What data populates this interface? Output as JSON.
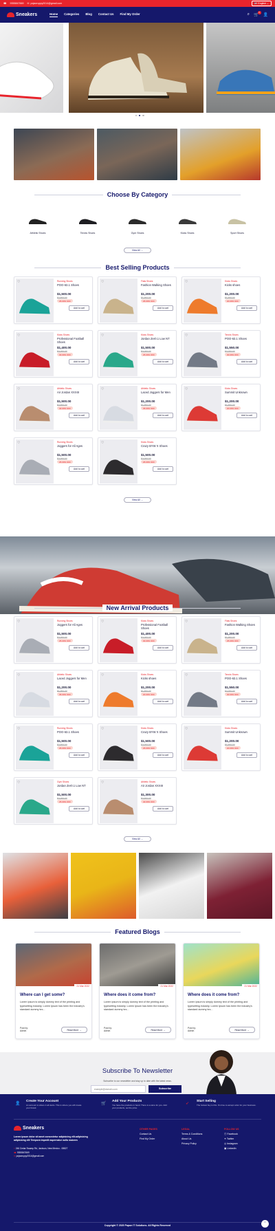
{
  "topbar": {
    "phone": "9355847669",
    "email": "pojaoruppy2014@gmail.com",
    "language": "English"
  },
  "nav": {
    "brand": "Sneakers",
    "items": [
      "Home",
      "Categories",
      "Blog",
      "Contact Us",
      "Find My Order"
    ],
    "cart_count": "0"
  },
  "categories": {
    "title": "Choose By Category",
    "items": [
      "Athletic Shoes",
      "Tennis Shoes",
      "Gym Shoes",
      "Kicks Shoes",
      "Sport Shoes"
    ],
    "view_all": "View All"
  },
  "best": {
    "title": "Best Selling Products",
    "view_all": "View All",
    "add_label": "Add to cart",
    "products": [
      {
        "cat": "Running Shoes",
        "name": "POO-63.1 Shoes",
        "price": "$1,500.00",
        "old": "$2,500.00",
        "off": "25.00% OFF",
        "color": "#1aa398"
      },
      {
        "cat": "Flats Shoes",
        "name": "Fashion Walking Shoes",
        "price": "$1,200.00",
        "old": "$1,900.00",
        "off": "25.00% OFF",
        "color": "#c9b38c"
      },
      {
        "cat": "Kicks Shoes",
        "name": "Kicks shoes",
        "price": "$1,200.00",
        "old": "$1,500.00",
        "off": "20.00% OFF",
        "color": "#ee7b2c"
      },
      {
        "cat": "Kicks Shoes",
        "name": "Professional Football Shoes",
        "price": "$1,400.00",
        "old": "$2,000.00",
        "off": "30.00% OFF",
        "color": "#c81d28"
      },
      {
        "cat": "Kicks Shoes",
        "name": "Jordan Zer0.1 Low NT",
        "price": "$1,500.00",
        "old": "$2,000.00",
        "off": "25.00% OFF",
        "color": "#2aa88a"
      },
      {
        "cat": "Tennis Shoes",
        "name": "POO-63.1 Shoes",
        "price": "$1,550.00",
        "old": "$2,200.00",
        "off": "30.00% OFF",
        "color": "#737a86"
      },
      {
        "cat": "Athletic Shoes",
        "name": "Air Jordan XXXIII",
        "price": "$1,500.00",
        "old": "$2,500.00",
        "off": "40.00% OFF",
        "color": "#b98d6f"
      },
      {
        "cat": "Athletic Shoes",
        "name": "Laced Joggers for Men",
        "price": "$1,200.00",
        "old": "$1,900.00",
        "off": "35.00% OFF",
        "color": "#d7dbe2"
      },
      {
        "cat": "Kicks Shoes",
        "name": "Summit Unknown",
        "price": "$1,200.00",
        "old": "$1,500.00",
        "off": "20.00% OFF",
        "color": "#dd3a35"
      },
      {
        "cat": "Running Shoes",
        "name": "Joggers for All Ages",
        "price": "$1,500.00",
        "old": "$2,000.00",
        "off": "25.00% OFF",
        "color": "#a9adb5"
      },
      {
        "cat": "Kicks Shoes",
        "name": "Crazy BYW X Shoes",
        "price": "$1,500.00",
        "old": "$2,000.00",
        "off": "25.00% OFF",
        "color": "#2d2b2e"
      }
    ]
  },
  "newarr": {
    "title": "New Arrival Products",
    "view_all": "View All",
    "add_label": "Add to cart",
    "products": [
      {
        "cat": "Running Shoes",
        "name": "Joggers for All Ages",
        "price": "$1,500.00",
        "old": "$2,000.00",
        "off": "25.00% OFF",
        "color": "#a9adb5"
      },
      {
        "cat": "Kicks Shoes",
        "name": "Professional Football Shoes",
        "price": "$1,400.00",
        "old": "$2,000.00",
        "off": "30.00% OFF",
        "color": "#c81d28"
      },
      {
        "cat": "Flats Shoes",
        "name": "Fashion Walking Shoes",
        "price": "$1,200.00",
        "old": "$1,900.00",
        "off": "25.00% OFF",
        "color": "#c9b38c"
      },
      {
        "cat": "Athletic Shoes",
        "name": "Laced Joggers for Men",
        "price": "$1,200.00",
        "old": "$1,900.00",
        "off": "35.00% OFF",
        "color": "#d7dbe2"
      },
      {
        "cat": "Kicks Shoes",
        "name": "Kicks shoes",
        "price": "$1,200.00",
        "old": "$1,500.00",
        "off": "20.00% OFF",
        "color": "#ee7b2c"
      },
      {
        "cat": "Tennis Shoes",
        "name": "POO-63.1 Shoes",
        "price": "$1,550.00",
        "old": "$2,200.00",
        "off": "30.00% OFF",
        "color": "#737a86"
      },
      {
        "cat": "Running Shoes",
        "name": "POO-63.1 Shoes",
        "price": "$1,500.00",
        "old": "$2,500.00",
        "off": "25.00% OFF",
        "color": "#1aa398"
      },
      {
        "cat": "Kicks Shoes",
        "name": "Crazy BYW X Shoes",
        "price": "$1,500.00",
        "old": "$2,000.00",
        "off": "25.00% OFF",
        "color": "#2d2b2e"
      },
      {
        "cat": "Kicks Shoes",
        "name": "Summit Unknown",
        "price": "$1,200.00",
        "old": "$1,500.00",
        "off": "20.00% OFF",
        "color": "#dd3a35"
      },
      {
        "cat": "Gym Shoes",
        "name": "Jordan Zer0.1 Low NT",
        "price": "$1,500.00",
        "old": "$2,000.00",
        "off": "25.00% OFF",
        "color": "#2aa88a"
      },
      {
        "cat": "Athletic Shoes",
        "name": "Air Jordan XXXIII",
        "price": "$1,300.00",
        "old": "$2,500.00",
        "off": "40.00% OFF",
        "color": "#b98d6f"
      }
    ]
  },
  "blogs": {
    "title": "Featured Blogs",
    "read_more": "Read More",
    "posts": [
      {
        "date": "21 Mar 2022",
        "title": "Where can I get some?",
        "desc": "Lorem Ipsum is simply dummy text of the printing and typesetting industry. Lorem Ipsum has been the industry's standard dummy tex...",
        "by": "Post by:",
        "author": "Admin"
      },
      {
        "date": "21 Mar 2022",
        "title": "Where does it come from?",
        "desc": "Lorem Ipsum is simply dummy text of the printing and typesetting industry. Lorem Ipsum has been the industry's standard dummy tex...",
        "by": "Post by:",
        "author": "Admin"
      },
      {
        "date": "21 Mar 2022",
        "title": "Where does it come from?",
        "desc": "Lorem Ipsum is simply dummy text of the printing and typesetting industry. Lorem Ipsum has been the industry's standard dummy tex...",
        "by": "Post by:",
        "author": "Admin"
      }
    ]
  },
  "newsletter": {
    "title": "Subscribe To Newsletter",
    "text": "Subscribe to our newsletter and stay up to date with the latest news.",
    "placeholder": "example@domain.com",
    "button": "Subscribe"
  },
  "features": [
    {
      "title": "Create Your Account",
      "text": "An account is where it all starts. This is where you will create your brand."
    },
    {
      "title": "Add Your Products",
      "text": "You have the products in hand. There is a store for you. Add your products, set the price."
    },
    {
      "title": "Start Selling",
      "text": "The hottest buy is this. It's time to accept order for your business."
    }
  ],
  "footer": {
    "brand": "Sneakers",
    "about": "Lorem ipsum dolor sit amet consectetur adipisicing elit.adipisicing adipisicing elit Tempora impedit aspernatur nulla maiores",
    "address": "246 Cedar Swamp Rd, Jackson, New Mexico - 08827",
    "phone": "9355847669",
    "email": "pojaoruppy2014@gmail.com",
    "other_title": "OTHER PAGES",
    "other": [
      "Contact Us",
      "Find My Order"
    ],
    "legal_title": "LEGAL",
    "legal": [
      "Terms & Conditions",
      "About Us",
      "Privacy Policy"
    ],
    "follow_title": "FOLLOW US",
    "follow": [
      "Facebook",
      "Twitter",
      "Instagram",
      "LinkedIn"
    ],
    "copyright": "Copyright © 2020 Papun IT Solutions. All Rights Reserved"
  },
  "colors": {
    "brand": "#15186b",
    "accent": "#e8242c"
  }
}
